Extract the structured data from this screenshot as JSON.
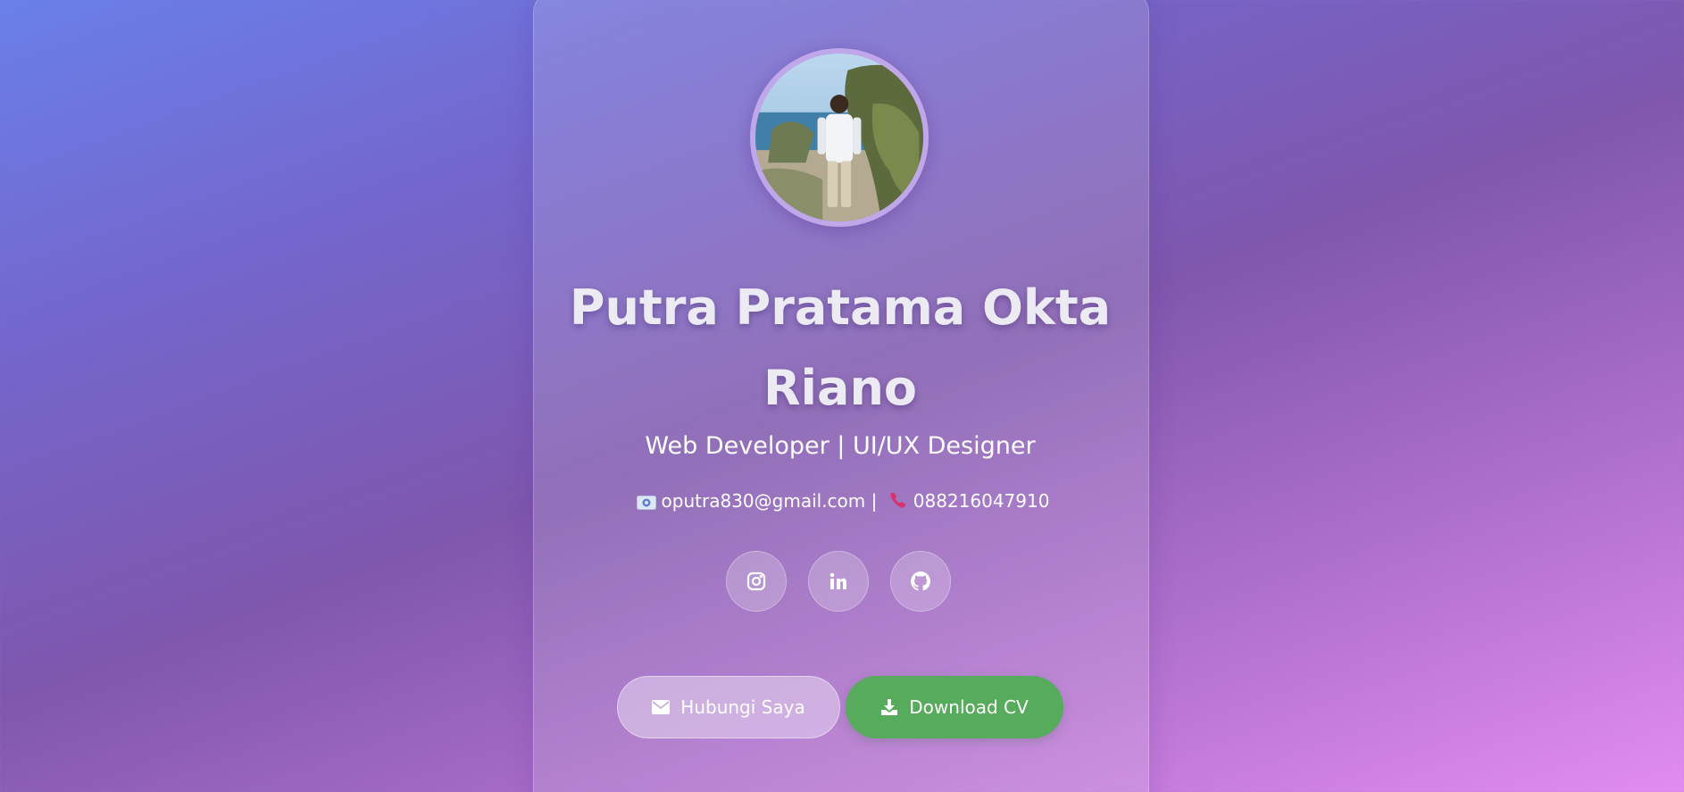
{
  "profile": {
    "name_line1": "Putra Pratama Okta",
    "name_line2": "Riano",
    "role": "Web Developer | UI/UX Designer",
    "email_icon": "email-card-icon",
    "email": "oputra830@gmail.com",
    "separator": "|",
    "phone_icon": "telephone-icon",
    "phone": "088216047910"
  },
  "socials": [
    {
      "icon": "instagram-icon"
    },
    {
      "icon": "linkedin-icon"
    },
    {
      "icon": "github-icon"
    }
  ],
  "actions": {
    "contact_label": "Hubungi Saya",
    "contact_icon": "envelope-icon",
    "download_label": "Download CV",
    "download_icon": "download-icon"
  },
  "colors": {
    "download_button": "#56ab5c",
    "avatar_border": "#c3aaeb"
  }
}
